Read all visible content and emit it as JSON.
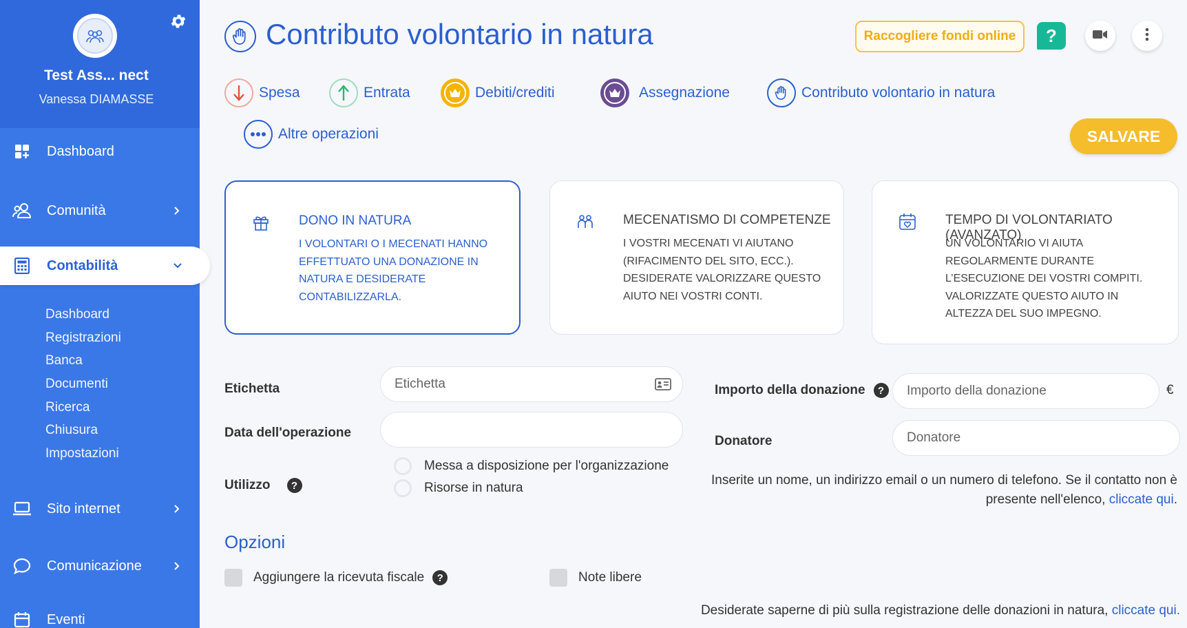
{
  "sidebar": {
    "org_name": "Test Ass... nect",
    "user_name": "Vanessa DIAMASSE",
    "items": [
      {
        "label": "Dashboard",
        "icon": "dashboard-icon"
      },
      {
        "label": "Comunità",
        "icon": "community-icon"
      },
      {
        "label": "Contabilità",
        "icon": "calculator-icon"
      },
      {
        "label": "Sito internet",
        "icon": "laptop-icon"
      },
      {
        "label": "Comunicazione",
        "icon": "chat-icon"
      },
      {
        "label": "Eventi",
        "icon": "calendar-icon"
      }
    ],
    "sub_items": [
      "Dashboard",
      "Registrazioni",
      "Banca",
      "Documenti",
      "Ricerca",
      "Chiusura",
      "Impostazioni"
    ]
  },
  "header": {
    "title": "Contributo volontario in natura",
    "fund_button": "Raccogliere fondi online",
    "help_label": "?"
  },
  "operations": [
    {
      "label": "Spesa",
      "icon": "arrow-down-icon",
      "color": "#e5533d"
    },
    {
      "label": "Entrata",
      "icon": "arrow-up-icon",
      "color": "#2bb673"
    },
    {
      "label": "Debiti/crediti",
      "icon": "crown-icon",
      "color": "#f5b400"
    },
    {
      "label": "Assegnazione",
      "icon": "crown-exchange-icon",
      "color": "#6a4c93"
    },
    {
      "label": "Contributo volontario in natura",
      "icon": "hand-icon",
      "color": "#2a5fcf"
    },
    {
      "label": "Altre operazioni",
      "icon": "more-dots-icon",
      "color": "#2a5fcf"
    }
  ],
  "save_button": "SALVARE",
  "cards": [
    {
      "title": "DONO IN NATURA",
      "desc": "I VOLONTARI O I MECENATI HANNO EFFETTUATO UNA DONAZIONE IN NATURA E DESIDERATE CONTABILIZZARLA.",
      "icon": "gift-icon",
      "selected": true
    },
    {
      "title": "MECENATISMO DI COMPETENZE",
      "desc": "I VOSTRI MECENATI VI AIUTANO (RIFACIMENTO DEL SITO, ECC.). DESIDERATE VALORIZZARE QUESTO AIUTO NEI VOSTRI CONTI.",
      "icon": "people-icon",
      "selected": false
    },
    {
      "title": "TEMPO DI VOLONTARIATO (AVANZATO)",
      "desc": "UN VOLONTARIO VI AIUTA REGOLARMENTE DURANTE L’ESECUZIONE DEI VOSTRI COMPITI. VALORIZZATE QUESTO AIUTO IN ALTEZZA DEL SUO IMPEGNO.",
      "icon": "calendar-heart-icon",
      "selected": false
    }
  ],
  "form": {
    "etichetta_label": "Etichetta",
    "etichetta_placeholder": "Etichetta",
    "data_label": "Data dell'operazione",
    "data_value": "",
    "utilizzo_label": "Utilizzo",
    "utilizzo_options": [
      "Messa a disposizione per l'organizzazione",
      "Risorse in natura"
    ],
    "importo_label": "Importo della donazione",
    "importo_placeholder": "Importo della donazione",
    "currency": "€",
    "donatore_label": "Donatore",
    "donatore_placeholder": "Donatore",
    "hint_text": "Inserite un nome, un indirizzo email o un numero di telefono. Se il contatto non è presente nell'elenco,",
    "hint_link": "cliccate qui"
  },
  "options": {
    "title": "Opzioni",
    "receipt_label": "Aggiungere la ricevuta fiscale",
    "notes_label": "Note libere"
  },
  "footer": {
    "text": "Desiderate saperne di più sulla registrazione delle donazioni in natura,",
    "link": "cliccate qui."
  }
}
